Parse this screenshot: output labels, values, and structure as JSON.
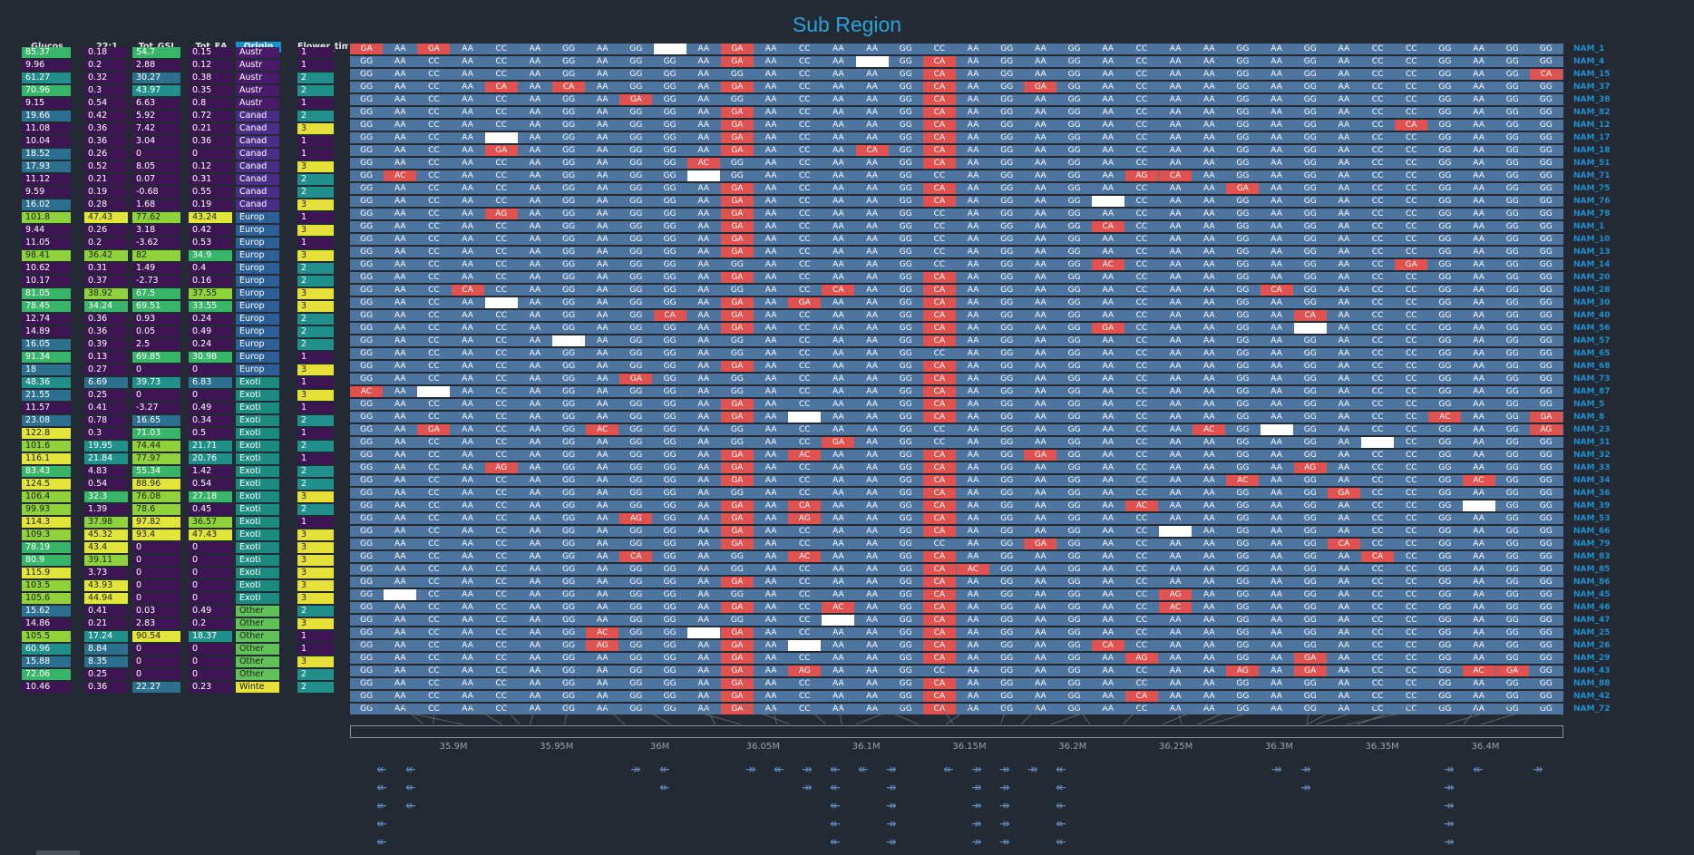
{
  "title": "Sub Region",
  "columns": [
    "Glucos",
    "22:1",
    "Tot_GSL",
    "Tot_EA",
    "Origin",
    "Flower_tim"
  ],
  "rows": [
    [
      "NAM_1",
      [
        85.37,
        0.18,
        54.7,
        0.15
      ],
      "Austr",
      1
    ],
    [
      "NAM_4",
      [
        9.96,
        0.2,
        2.88,
        0.12
      ],
      "Austr",
      1
    ],
    [
      "NAM_15",
      [
        61.27,
        0.32,
        30.27,
        0.38
      ],
      "Austr",
      2
    ],
    [
      "NAM_37",
      [
        70.96,
        0.3,
        43.97,
        0.35
      ],
      "Austr",
      2
    ],
    [
      "NAM_38",
      [
        9.15,
        0.54,
        6.63,
        0.8
      ],
      "Austr",
      1
    ],
    [
      "NAM_82",
      [
        19.66,
        0.42,
        5.92,
        0.72
      ],
      "Canad",
      2
    ],
    [
      "NAM_12",
      [
        11.08,
        0.36,
        7.42,
        0.21
      ],
      "Canad",
      3
    ],
    [
      "NAM_17",
      [
        10.04,
        0.36,
        3.04,
        0.36
      ],
      "Canad",
      1
    ],
    [
      "NAM_18",
      [
        18.52,
        0.26,
        0,
        0
      ],
      "Canad",
      1
    ],
    [
      "NAM_51",
      [
        17.93,
        0.52,
        8.05,
        0.12
      ],
      "Canad",
      3
    ],
    [
      "NAM_71",
      [
        11.12,
        0.21,
        0.07,
        0.31
      ],
      "Canad",
      2
    ],
    [
      "NAM_75",
      [
        9.59,
        0.19,
        -0.68,
        0.55
      ],
      "Canad",
      2
    ],
    [
      "NAM_76",
      [
        16.02,
        0.28,
        1.68,
        0.19
      ],
      "Canad",
      3
    ],
    [
      "NAM_78",
      [
        101.8,
        47.43,
        77.62,
        43.24
      ],
      "Europ",
      1
    ],
    [
      "NAM_1",
      [
        9.44,
        0.26,
        3.18,
        0.42
      ],
      "Europ",
      3
    ],
    [
      "NAM_10",
      [
        11.05,
        0.2,
        -3.62,
        0.53
      ],
      "Europ",
      1
    ],
    [
      "NAM_13",
      [
        98.41,
        36.42,
        82,
        34.9
      ],
      "Europ",
      3
    ],
    [
      "NAM_14",
      [
        10.62,
        0.31,
        1.49,
        0.4
      ],
      "Europ",
      2
    ],
    [
      "NAM_20",
      [
        10.17,
        0.37,
        -2.73,
        0.16
      ],
      "Europ",
      2
    ],
    [
      "NAM_28",
      [
        81.05,
        38.92,
        67.5,
        37.55
      ],
      "Europ",
      3
    ],
    [
      "NAM_30",
      [
        78.45,
        34.24,
        69.51,
        33.55
      ],
      "Europ",
      3
    ],
    [
      "NAM_40",
      [
        12.74,
        0.36,
        0.93,
        0.24
      ],
      "Europ",
      2
    ],
    [
      "NAM_56",
      [
        14.89,
        0.36,
        0.05,
        0.49
      ],
      "Europ",
      2
    ],
    [
      "NAM_57",
      [
        16.05,
        0.39,
        2.5,
        0.24
      ],
      "Europ",
      2
    ],
    [
      "NAM_65",
      [
        91.34,
        0.13,
        69.85,
        30.98
      ],
      "Europ",
      1
    ],
    [
      "NAM_68",
      [
        18,
        0.27,
        0,
        0
      ],
      "Europ",
      3
    ],
    [
      "NAM_73",
      [
        48.36,
        6.69,
        39.73,
        6.83
      ],
      "Exoti",
      1
    ],
    [
      "NAM_87",
      [
        21.55,
        0.25,
        0,
        0
      ],
      "Exoti",
      3
    ],
    [
      "NAM_5",
      [
        11.57,
        0.41,
        -3.27,
        0.49
      ],
      "Exoti",
      1
    ],
    [
      "NAM_8",
      [
        23.08,
        0.78,
        16.65,
        0.34
      ],
      "Exoti",
      2
    ],
    [
      "NAM_23",
      [
        122.8,
        0.3,
        71.03,
        0.5
      ],
      "Exoti",
      1
    ],
    [
      "NAM_31",
      [
        101.6,
        19.95,
        74.44,
        21.71
      ],
      "Exoti",
      2
    ],
    [
      "NAM_32",
      [
        116.1,
        21.84,
        77.97,
        20.76
      ],
      "Exoti",
      1
    ],
    [
      "NAM_33",
      [
        83.43,
        4.83,
        55.34,
        1.42
      ],
      "Exoti",
      2
    ],
    [
      "NAM_34",
      [
        124.5,
        0.54,
        88.96,
        0.54
      ],
      "Exoti",
      2
    ],
    [
      "NAM_36",
      [
        106.4,
        32.3,
        76.08,
        27.18
      ],
      "Exoti",
      3
    ],
    [
      "NAM_39",
      [
        99.93,
        1.39,
        78.6,
        0.45
      ],
      "Exoti",
      2
    ],
    [
      "NAM_53",
      [
        114.3,
        37.98,
        97.82,
        36.57
      ],
      "Exoti",
      1
    ],
    [
      "NAM_66",
      [
        109.3,
        45.32,
        93.4,
        47.43
      ],
      "Exoti",
      3
    ],
    [
      "NAM_79",
      [
        78.19,
        43.4,
        0,
        0
      ],
      "Exoti",
      3
    ],
    [
      "NAM_83",
      [
        80.9,
        39.11,
        0,
        0
      ],
      "Exoti",
      3
    ],
    [
      "NAM_85",
      [
        115.9,
        3.73,
        0,
        0
      ],
      "Exoti",
      3
    ],
    [
      "NAM_86",
      [
        103.5,
        43.93,
        0,
        0
      ],
      "Exoti",
      3
    ],
    [
      "NAM_45",
      [
        105.6,
        44.94,
        0,
        0
      ],
      "Exoti",
      3
    ],
    [
      "NAM_46",
      [
        15.62,
        0.41,
        0.03,
        0.49
      ],
      "Other",
      2
    ],
    [
      "NAM_47",
      [
        14.86,
        0.21,
        2.83,
        0.2
      ],
      "Other",
      3
    ],
    [
      "NAM_25",
      [
        105.5,
        17.24,
        90.54,
        18.37
      ],
      "Other",
      1
    ],
    [
      "NAM_26",
      [
        60.96,
        8.84,
        0,
        0
      ],
      "Other",
      1
    ],
    [
      "NAM_29",
      [
        15.88,
        8.35,
        0,
        0
      ],
      "Other",
      3
    ],
    [
      "NAM_43",
      [
        72.06,
        0.25,
        0,
        0
      ],
      "Other",
      2
    ],
    [
      "NAM_88",
      [
        10.46,
        0.36,
        22.27,
        0.23
      ],
      "Winte",
      2
    ],
    [
      "NAM_42",
      null,
      null,
      null
    ],
    [
      "NAM_72",
      null,
      null,
      null
    ]
  ],
  "genotypes": [
    "GG",
    "AA",
    "CC",
    "AA",
    "CC",
    "AA",
    "GG",
    "AA",
    "GG",
    "GG",
    "AA",
    "GG",
    "AA",
    "CC",
    "AA",
    "AA",
    "GG",
    "CC",
    "AA",
    "GG",
    "AA",
    "GG",
    "AA",
    "CC",
    "AA",
    "AA",
    "GG",
    "AA",
    "GG",
    "AA",
    "CC",
    "CC",
    "GG",
    "AA",
    "GG",
    "GG"
  ],
  "axis_ticks": [
    "35.9M",
    "35.95M",
    "36M",
    "36.05M",
    "36.1M",
    "36.15M",
    "36.2M",
    "36.25M",
    "36.3M",
    "36.35M",
    "36.4M"
  ]
}
